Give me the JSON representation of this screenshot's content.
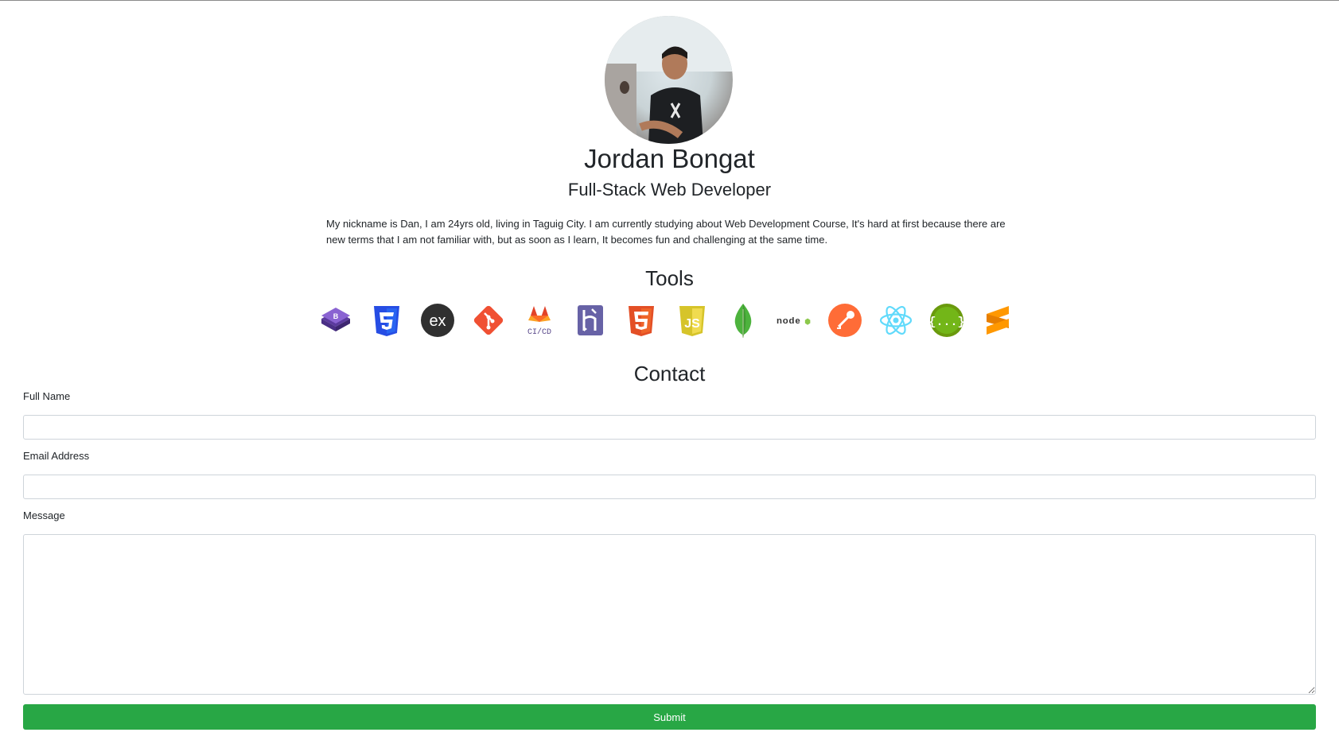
{
  "profile": {
    "name": "Jordan Bongat",
    "title": "Full-Stack Web Developer",
    "bio": "My nickname is Dan, I am 24yrs old, living in Taguig City. I am currently studying about Web Development Course, It's hard at first because there are new terms that I am not familiar with, but as soon as I learn, It becomes fun and challenging at the same time."
  },
  "tools": {
    "heading": "Tools",
    "items": [
      {
        "icon": "bootstrap-icon",
        "color": "#7952b3"
      },
      {
        "icon": "css3-icon",
        "color": "#264de4"
      },
      {
        "icon": "express-icon",
        "color": "#303030",
        "text": "ex"
      },
      {
        "icon": "git-icon",
        "color": "#f05033"
      },
      {
        "icon": "gitlab-cicd-icon",
        "color": "#e24329",
        "text": "CI/CD"
      },
      {
        "icon": "heroku-icon",
        "color": "#6762a6"
      },
      {
        "icon": "html5-icon",
        "color": "#e34f26"
      },
      {
        "icon": "javascript-icon",
        "color": "#f0db4f",
        "text": "JS"
      },
      {
        "icon": "mongodb-icon",
        "color": "#4db33d"
      },
      {
        "icon": "nodejs-icon",
        "color": "#3c873a",
        "text": "node"
      },
      {
        "icon": "postman-icon",
        "color": "#ff6c37"
      },
      {
        "icon": "react-icon",
        "color": "#61dafb"
      },
      {
        "icon": "swagger-icon",
        "color": "#6a9a0d",
        "text": "{...}"
      },
      {
        "icon": "sublime-text-icon",
        "color": "#ff9800"
      }
    ]
  },
  "contact": {
    "heading": "Contact",
    "full_name_label": "Full Name",
    "full_name_value": "",
    "email_label": "Email Address",
    "email_value": "",
    "message_label": "Message",
    "message_value": "",
    "submit_label": "Submit",
    "submit_color": "#28a745"
  }
}
